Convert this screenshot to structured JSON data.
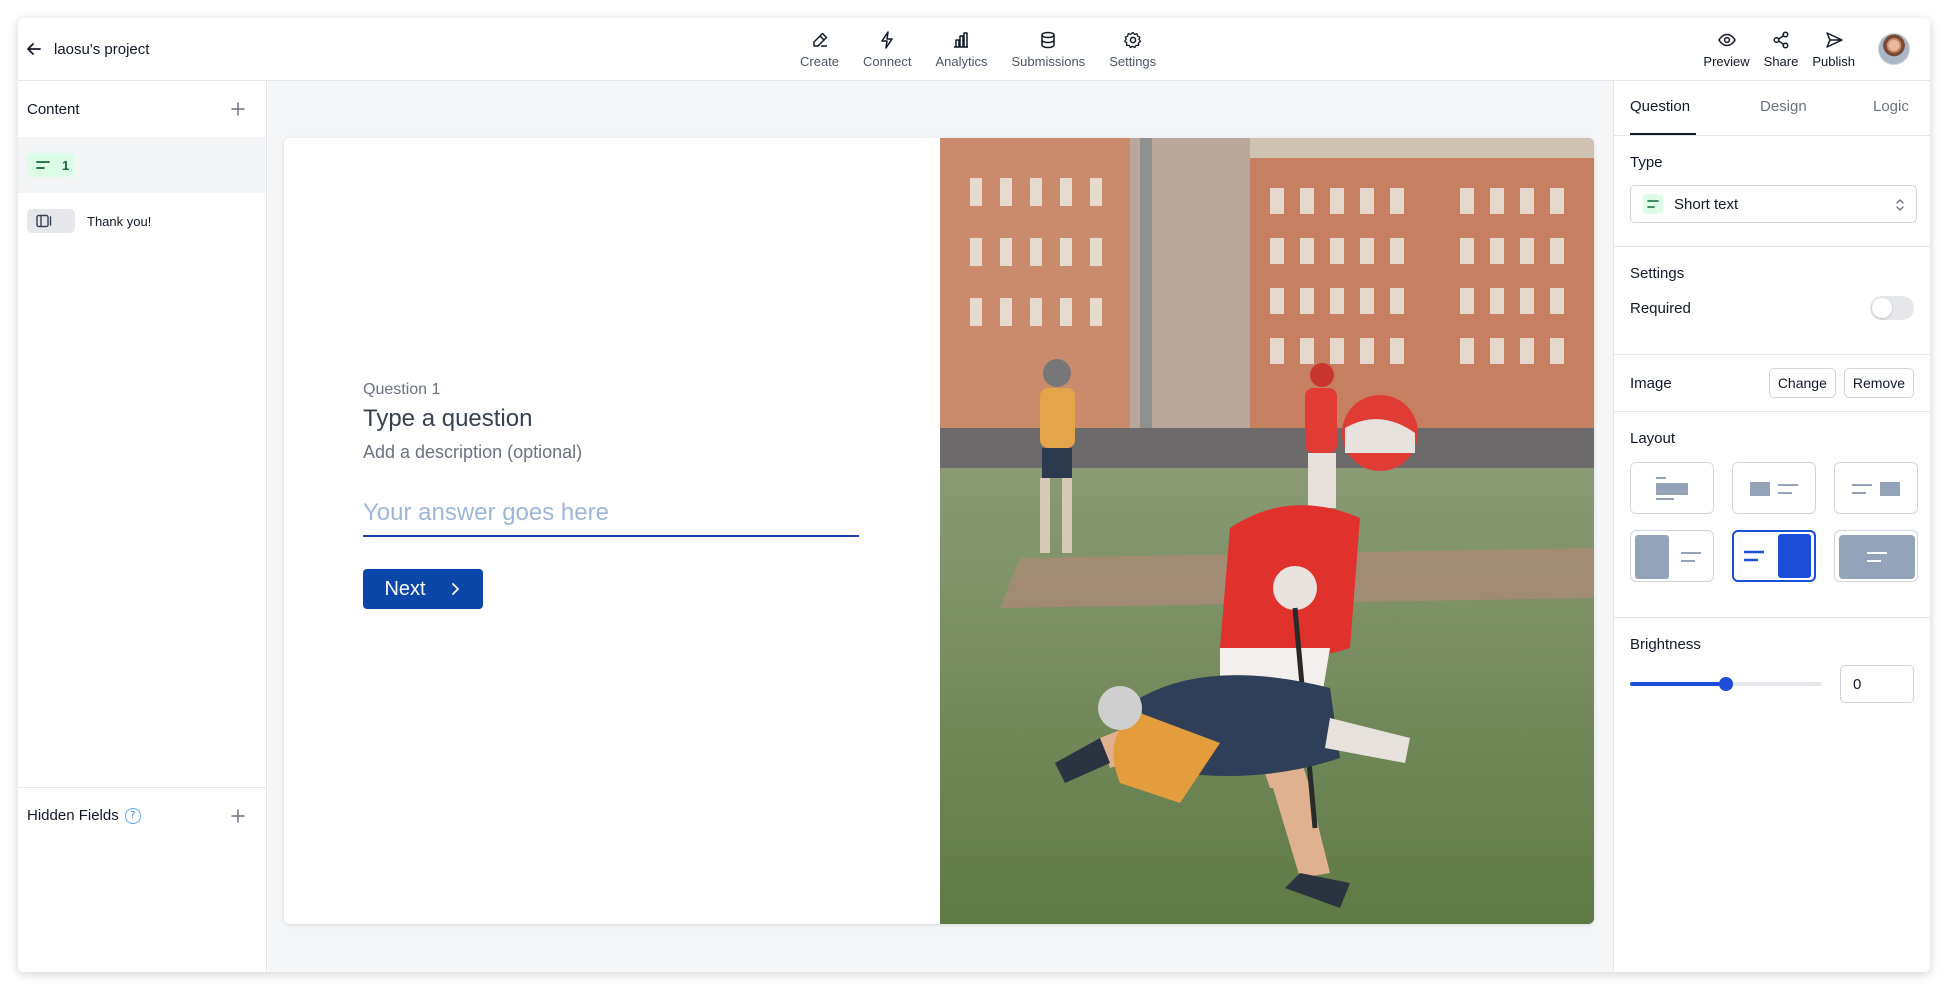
{
  "topbar": {
    "project_title": "laosu's project",
    "center_nav": [
      {
        "label": "Create",
        "icon": "edit-icon"
      },
      {
        "label": "Connect",
        "icon": "lightning-icon"
      },
      {
        "label": "Analytics",
        "icon": "bar-chart-icon"
      },
      {
        "label": "Submissions",
        "icon": "database-icon"
      },
      {
        "label": "Settings",
        "icon": "gear-icon"
      }
    ],
    "right_nav": [
      {
        "label": "Preview",
        "icon": "eye-icon"
      },
      {
        "label": "Share",
        "icon": "share-icon"
      },
      {
        "label": "Publish",
        "icon": "send-icon"
      }
    ]
  },
  "sidebar": {
    "content_label": "Content",
    "items": [
      {
        "badge": "1",
        "label": "",
        "icon": "short-text-icon",
        "active": true
      },
      {
        "badge": "",
        "label": "Thank you!",
        "icon": "ending-icon",
        "active": false
      }
    ],
    "hidden_fields_label": "Hidden Fields",
    "help_glyph": "?"
  },
  "form": {
    "question_number": "Question 1",
    "question_title": "Type a question",
    "description": "Add a description (optional)",
    "answer_placeholder": "Your answer goes here",
    "next_label": "Next"
  },
  "panel": {
    "tabs": [
      "Question",
      "Design",
      "Logic"
    ],
    "active_tab": "Question",
    "type_label": "Type",
    "type_value": "Short text",
    "settings_label": "Settings",
    "required_label": "Required",
    "required_on": false,
    "image_label": "Image",
    "change_label": "Change",
    "remove_label": "Remove",
    "layout_label": "Layout",
    "selected_layout_index": 4,
    "brightness_label": "Brightness",
    "brightness_value": "0",
    "brightness_slider_fraction": 0.5
  },
  "colors": {
    "primary": "#0b47a8",
    "accent": "#1d4ed8",
    "short_text_badge": "#dcfce7",
    "layout_gray": "#94a3b8"
  }
}
